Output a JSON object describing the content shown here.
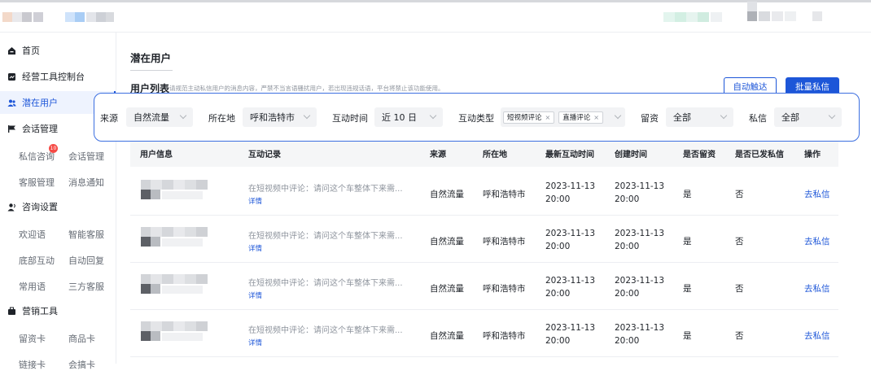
{
  "sidebar": {
    "items": [
      {
        "label": "首页",
        "icon": "home-icon"
      },
      {
        "label": "经营工具控制台",
        "icon": "dashboard-icon"
      },
      {
        "label": "潜在用户",
        "icon": "users-icon",
        "active": true
      },
      {
        "label": "会话管理",
        "icon": "flag-icon"
      },
      {
        "label": "咨询设置",
        "icon": "consult-icon"
      },
      {
        "label": "营销工具",
        "icon": "briefcase-icon"
      }
    ],
    "sub_items": {
      "private_msg": "私信咨询",
      "private_msg_badge": "10",
      "session_mgmt": "会话管理",
      "cs_mgmt": "客服管理",
      "msg_notify": "消息通知",
      "welcome": "欢迎语",
      "smart_cs": "智能客服",
      "bottom_interact": "底部互动",
      "auto_reply": "自动回复",
      "common_phrases": "常用语",
      "third_party_cs": "三方客服",
      "lead_card": "留资卡",
      "product_card": "商品卡",
      "link_card": "链接卡",
      "coupon_card": "会搞卡"
    }
  },
  "main": {
    "title": "潜在用户",
    "list_title": "用户列表",
    "list_note": "请规范主动私信用户的消息内容，严禁不当言语骚扰用户，若出现违规话语，平台将禁止该功能使用。",
    "auto_reach_label": "自动触达",
    "batch_msg_label": "批量私信"
  },
  "filters": {
    "source_label": "来源",
    "source_value": "自然流量",
    "location_label": "所在地",
    "location_value": "呼和浩特市",
    "time_label": "互动时间",
    "time_value": "近 10 日",
    "type_label": "互动类型",
    "type_tags": [
      "短视频评论",
      "直播评论"
    ],
    "lead_label": "留资",
    "lead_value": "全部",
    "msg_label": "私信",
    "msg_value": "全部"
  },
  "table": {
    "headers": [
      "用户信息",
      "互动记录",
      "来源",
      "所在地",
      "最新互动时间",
      "创建时间",
      "是否留资",
      "是否已发私信",
      "操作"
    ],
    "rows": [
      {
        "record": "在短视频中评论：请问这个车整体下来需...",
        "detail": "详情",
        "source": "自然流量",
        "location": "呼和浩特市",
        "latest_date": "2023-11-13",
        "latest_time": "20:00",
        "created_date": "2023-11-13",
        "created_time": "20:00",
        "lead": "是",
        "sent": "否",
        "action": "去私信"
      },
      {
        "record": "在短视频中评论：请问这个车整体下来需...",
        "detail": "详情",
        "source": "自然流量",
        "location": "呼和浩特市",
        "latest_date": "2023-11-13",
        "latest_time": "20:00",
        "created_date": "2023-11-13",
        "created_time": "20:00",
        "lead": "是",
        "sent": "否",
        "action": "去私信"
      },
      {
        "record": "在短视频中评论：请问这个车整体下来需...",
        "detail": "详情",
        "source": "自然流量",
        "location": "呼和浩特市",
        "latest_date": "2023-11-13",
        "latest_time": "20:00",
        "created_date": "2023-11-13",
        "created_time": "20:00",
        "lead": "是",
        "sent": "否",
        "action": "去私信"
      },
      {
        "record": "在短视频中评论：请问这个车整体下来需...",
        "detail": "详情",
        "source": "自然流量",
        "location": "呼和浩特市",
        "latest_date": "2023-11-13",
        "latest_time": "20:00",
        "created_date": "2023-11-13",
        "created_time": "20:00",
        "lead": "是",
        "sent": "否",
        "action": "去私信"
      }
    ]
  },
  "colors": {
    "accent": "#1d56d8",
    "active_bg": "#eef3fe",
    "filter_border": "#3c6fe0"
  }
}
